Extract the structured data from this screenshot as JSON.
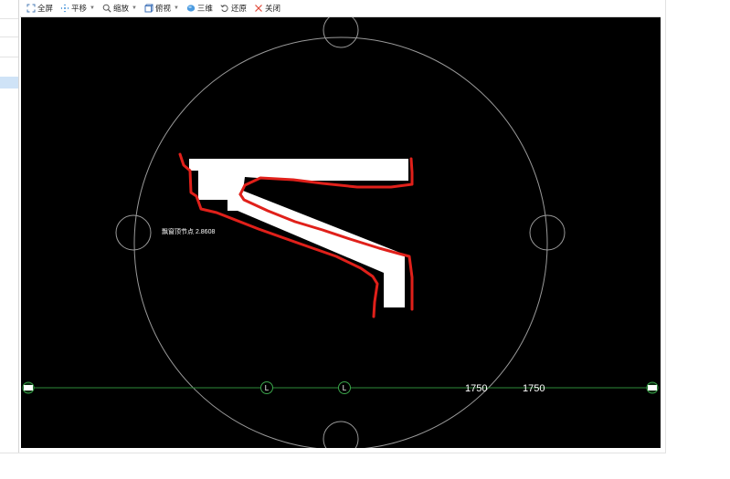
{
  "toolbar": {
    "buttons": [
      {
        "id": "fullscreen",
        "label": "全屏",
        "icon": "fullscreen-icon",
        "has_caret": false
      },
      {
        "id": "pan",
        "label": "平移",
        "icon": "pan-icon",
        "has_caret": true
      },
      {
        "id": "zoom",
        "label": "缩放",
        "icon": "zoom-icon",
        "has_caret": true
      },
      {
        "id": "view",
        "label": "俯视",
        "icon": "top-view-icon",
        "has_caret": true
      },
      {
        "id": "3d",
        "label": "三维",
        "icon": "3d-icon",
        "has_caret": false
      },
      {
        "id": "restore",
        "label": "还原",
        "icon": "restore-icon",
        "has_caret": false
      },
      {
        "id": "close",
        "label": "关闭",
        "icon": "close-icon",
        "has_caret": false
      }
    ]
  },
  "canvas": {
    "background": "#000000",
    "annotation_label": "飘窗顶节点 2.8608",
    "axis_markers": [
      "L",
      "L"
    ],
    "dimensions": [
      "1750",
      "1750"
    ],
    "colors": {
      "circle_stroke": "#9a9a9a",
      "axis_line": "#2e8b3a",
      "marker_stroke": "#3aa44a",
      "shape_fill": "#ffffff",
      "highlight_stroke": "#e0201a",
      "dimension_text": "#ffffff",
      "label_text": "#ffffff"
    }
  }
}
